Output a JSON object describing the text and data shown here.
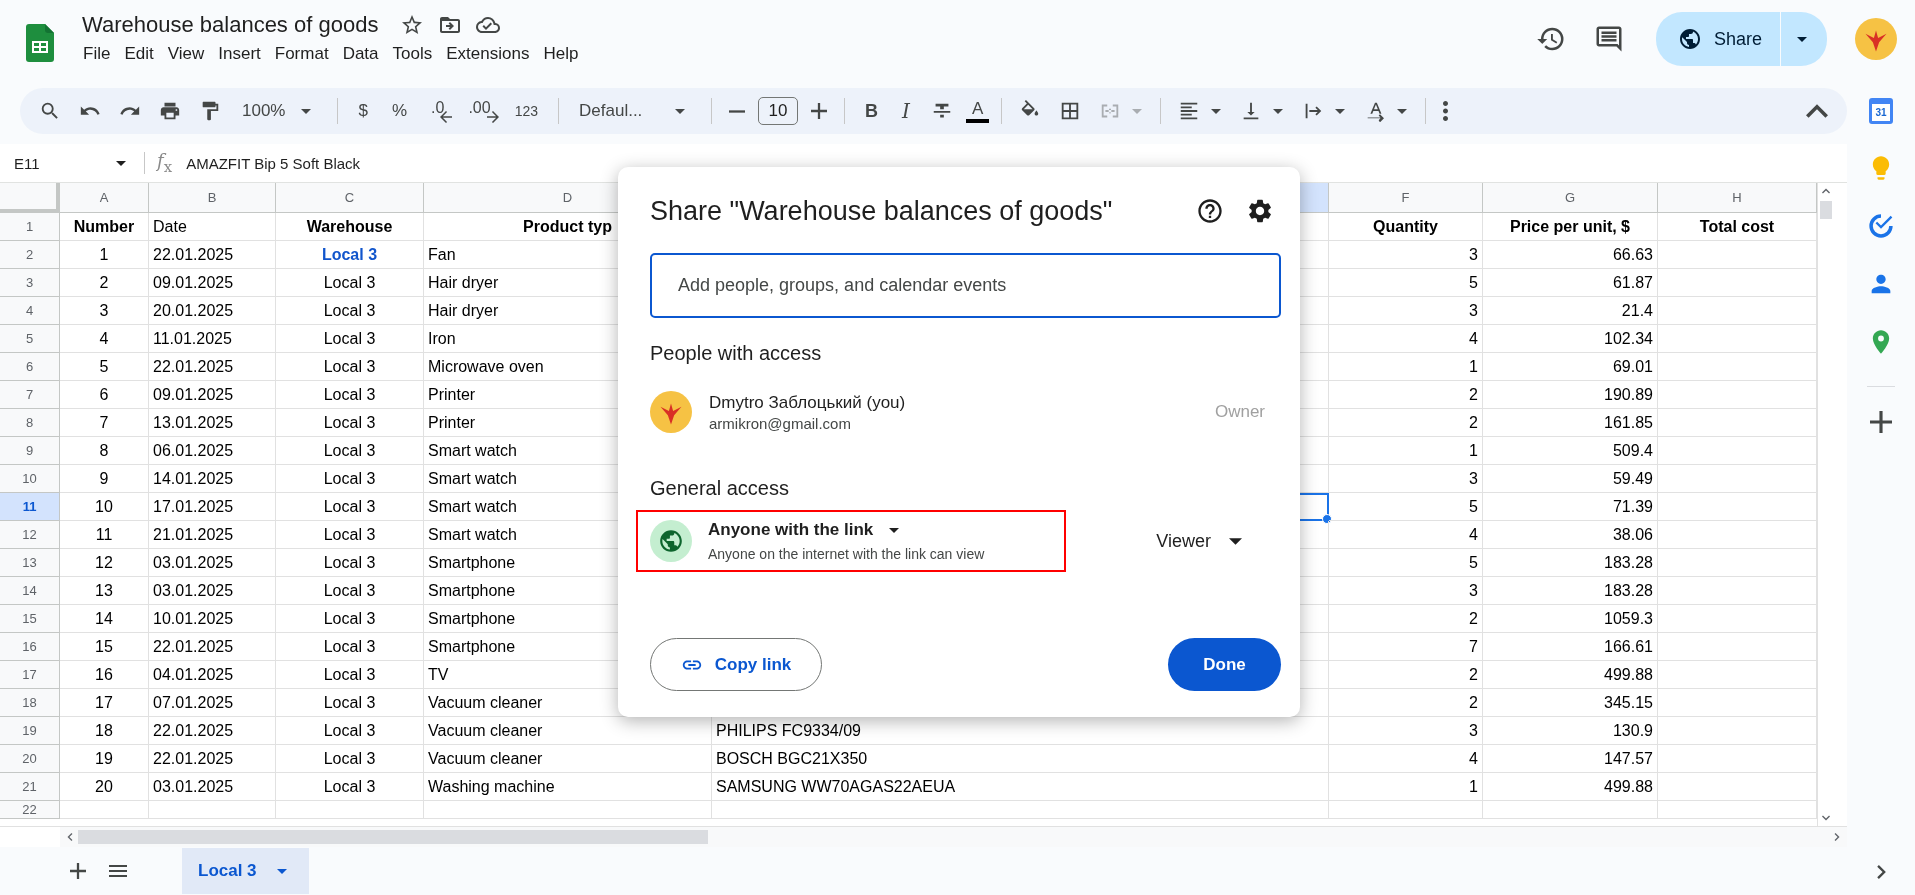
{
  "window": {
    "title": "Warehouse balances of goods"
  },
  "menu": [
    "File",
    "Edit",
    "View",
    "Insert",
    "Format",
    "Data",
    "Tools",
    "Extensions",
    "Help"
  ],
  "share_button": {
    "label": "Share"
  },
  "toolbar": {
    "zoom": "100%",
    "currency": "$",
    "percent": "%",
    "decrease_decimals": ".0",
    "increase_decimals": ".00",
    "number_format": "123",
    "font": "Defaul...",
    "font_size": "10",
    "bold": "B",
    "italic": "I",
    "text_color": "A",
    "merge_disabled": true
  },
  "formula_bar": {
    "cell_ref": "E11",
    "fx_label": "*f*$_{x}$",
    "value": "AMAZFIT Bip 5 Soft Black"
  },
  "sheet": {
    "columns": [
      {
        "label": "A",
        "selected": false
      },
      {
        "label": "B",
        "selected": false
      },
      {
        "label": "C",
        "selected": false
      },
      {
        "label": "D",
        "selected": false
      },
      {
        "selected": true
      },
      {
        "label": "F",
        "selected": false
      },
      {
        "label": "G",
        "selected": false
      },
      {
        "label": "H",
        "selected": false
      }
    ],
    "header_row": {
      "row": "1",
      "selected": false,
      "cells": [
        {
          "text": "Number",
          "bold": true
        },
        {
          "text": "Date",
          "bold": false
        },
        {
          "text": "Warehouse",
          "bold": true
        },
        {
          "text": "Product typ",
          "bold": true
        },
        null,
        {
          "text": "Quantity",
          "bold": true
        },
        {
          "text": "Price per unit, $",
          "bold": true
        },
        {
          "text": "Total cost",
          "bold": true
        }
      ]
    },
    "rows": [
      {
        "row": "2",
        "selected": false,
        "number": "1",
        "date": "22.01.2025",
        "warehouse": "Local 3",
        "warehouse_linked": true,
        "product_type": "Fan",
        "quantity": "3",
        "price": "66.63"
      },
      {
        "row": "3",
        "selected": false,
        "number": "2",
        "date": "09.01.2025",
        "warehouse": "Local 3",
        "warehouse_linked": false,
        "product_type": "Hair dryer",
        "quantity": "5",
        "price": "61.87"
      },
      {
        "row": "4",
        "selected": false,
        "number": "3",
        "date": "20.01.2025",
        "warehouse": "Local 3",
        "warehouse_linked": false,
        "product_type": "Hair dryer",
        "quantity": "3",
        "price": "21.4"
      },
      {
        "row": "5",
        "selected": false,
        "number": "4",
        "date": "11.01.2025",
        "warehouse": "Local 3",
        "warehouse_linked": false,
        "product_type": "Iron",
        "quantity": "4",
        "price": "102.34"
      },
      {
        "row": "6",
        "selected": false,
        "number": "5",
        "date": "22.01.2025",
        "warehouse": "Local 3",
        "warehouse_linked": false,
        "product_type": "Microwave oven",
        "quantity": "1",
        "price": "69.01"
      },
      {
        "row": "7",
        "selected": false,
        "number": "6",
        "date": "09.01.2025",
        "warehouse": "Local 3",
        "warehouse_linked": false,
        "product_type": "Printer",
        "quantity": "2",
        "price": "190.89"
      },
      {
        "row": "8",
        "selected": false,
        "number": "7",
        "date": "13.01.2025",
        "warehouse": "Local 3",
        "warehouse_linked": false,
        "product_type": "Printer",
        "quantity": "2",
        "price": "161.85"
      },
      {
        "row": "9",
        "selected": false,
        "number": "8",
        "date": "06.01.2025",
        "warehouse": "Local 3",
        "warehouse_linked": false,
        "product_type": "Smart watch",
        "quantity": "1",
        "price": "509.4"
      },
      {
        "row": "10",
        "selected": false,
        "number": "9",
        "date": "14.01.2025",
        "warehouse": "Local 3",
        "warehouse_linked": false,
        "product_type": "Smart watch",
        "quantity": "3",
        "price": "59.49"
      },
      {
        "row": "11",
        "selected": true,
        "number": "10",
        "date": "17.01.2025",
        "warehouse": "Local 3",
        "warehouse_linked": false,
        "product_type": "Smart watch",
        "quantity": "5",
        "price": "71.39"
      },
      {
        "row": "12",
        "selected": false,
        "number": "11",
        "date": "21.01.2025",
        "warehouse": "Local 3",
        "warehouse_linked": false,
        "product_type": "Smart watch",
        "quantity": "4",
        "price": "38.06"
      },
      {
        "row": "13",
        "selected": false,
        "number": "12",
        "date": "03.01.2025",
        "warehouse": "Local 3",
        "warehouse_linked": false,
        "product_type": "Smartphone",
        "quantity": "5",
        "price": "183.28"
      },
      {
        "row": "14",
        "selected": false,
        "number": "13",
        "date": "03.01.2025",
        "warehouse": "Local 3",
        "warehouse_linked": false,
        "product_type": "Smartphone",
        "quantity": "3",
        "price": "183.28"
      },
      {
        "row": "15",
        "selected": false,
        "number": "14",
        "date": "10.01.2025",
        "warehouse": "Local 3",
        "warehouse_linked": false,
        "product_type": "Smartphone",
        "quantity": "2",
        "price": "1059.3"
      },
      {
        "row": "16",
        "selected": false,
        "number": "15",
        "date": "22.01.2025",
        "warehouse": "Local 3",
        "warehouse_linked": false,
        "product_type": "Smartphone",
        "quantity": "7",
        "price": "166.61"
      },
      {
        "row": "17",
        "selected": false,
        "number": "16",
        "date": "04.01.2025",
        "warehouse": "Local 3",
        "warehouse_linked": false,
        "product_type": "TV",
        "quantity": "2",
        "price": "499.88"
      },
      {
        "row": "18",
        "selected": false,
        "number": "17",
        "date": "07.01.2025",
        "warehouse": "Local 3",
        "warehouse_linked": false,
        "product_type": "Vacuum cleaner",
        "quantity": "2",
        "price": "345.15"
      },
      {
        "row": "19",
        "selected": false,
        "number": "18",
        "date": "22.01.2025",
        "warehouse": "Local 3",
        "warehouse_linked": false,
        "product_type": "Vacuum cleaner",
        "column_e": "PHILIPS FC9334/09",
        "quantity": "3",
        "price": "130.9"
      },
      {
        "row": "20",
        "selected": false,
        "number": "19",
        "date": "22.01.2025",
        "warehouse": "Local 3",
        "warehouse_linked": false,
        "product_type": "Vacuum cleaner",
        "column_e": "BOSCH BGC21X350",
        "quantity": "4",
        "price": "147.57"
      },
      {
        "row": "21",
        "selected": false,
        "number": "20",
        "date": "03.01.2025",
        "warehouse": "Local 3",
        "warehouse_linked": false,
        "product_type": "Washing machine",
        "column_e": "SAMSUNG WW70AGAS22AEUA",
        "quantity": "1",
        "price": "499.88"
      }
    ],
    "partial_row": "22"
  },
  "sheet_tabs": [
    {
      "label": "Local 3",
      "selected": true
    }
  ],
  "side_panel": {
    "calendar_day": "31"
  },
  "share_dialog": {
    "title": "Share \"Warehouse balances of goods\"",
    "search": {
      "placeholder": "Add people, groups, and calendar events"
    },
    "people_heading": "People with access",
    "people": [
      {
        "name": "Dmytro Заблоцький (you)",
        "email": "armikron@gmail.com",
        "role": "Owner"
      }
    ],
    "general_heading": "General access",
    "general_access": {
      "scope": "Anyone with the link",
      "description": "Anyone on the internet with the link can view",
      "role": "Viewer",
      "annotated": true
    },
    "copy_link": "Copy link",
    "done": "Done"
  }
}
